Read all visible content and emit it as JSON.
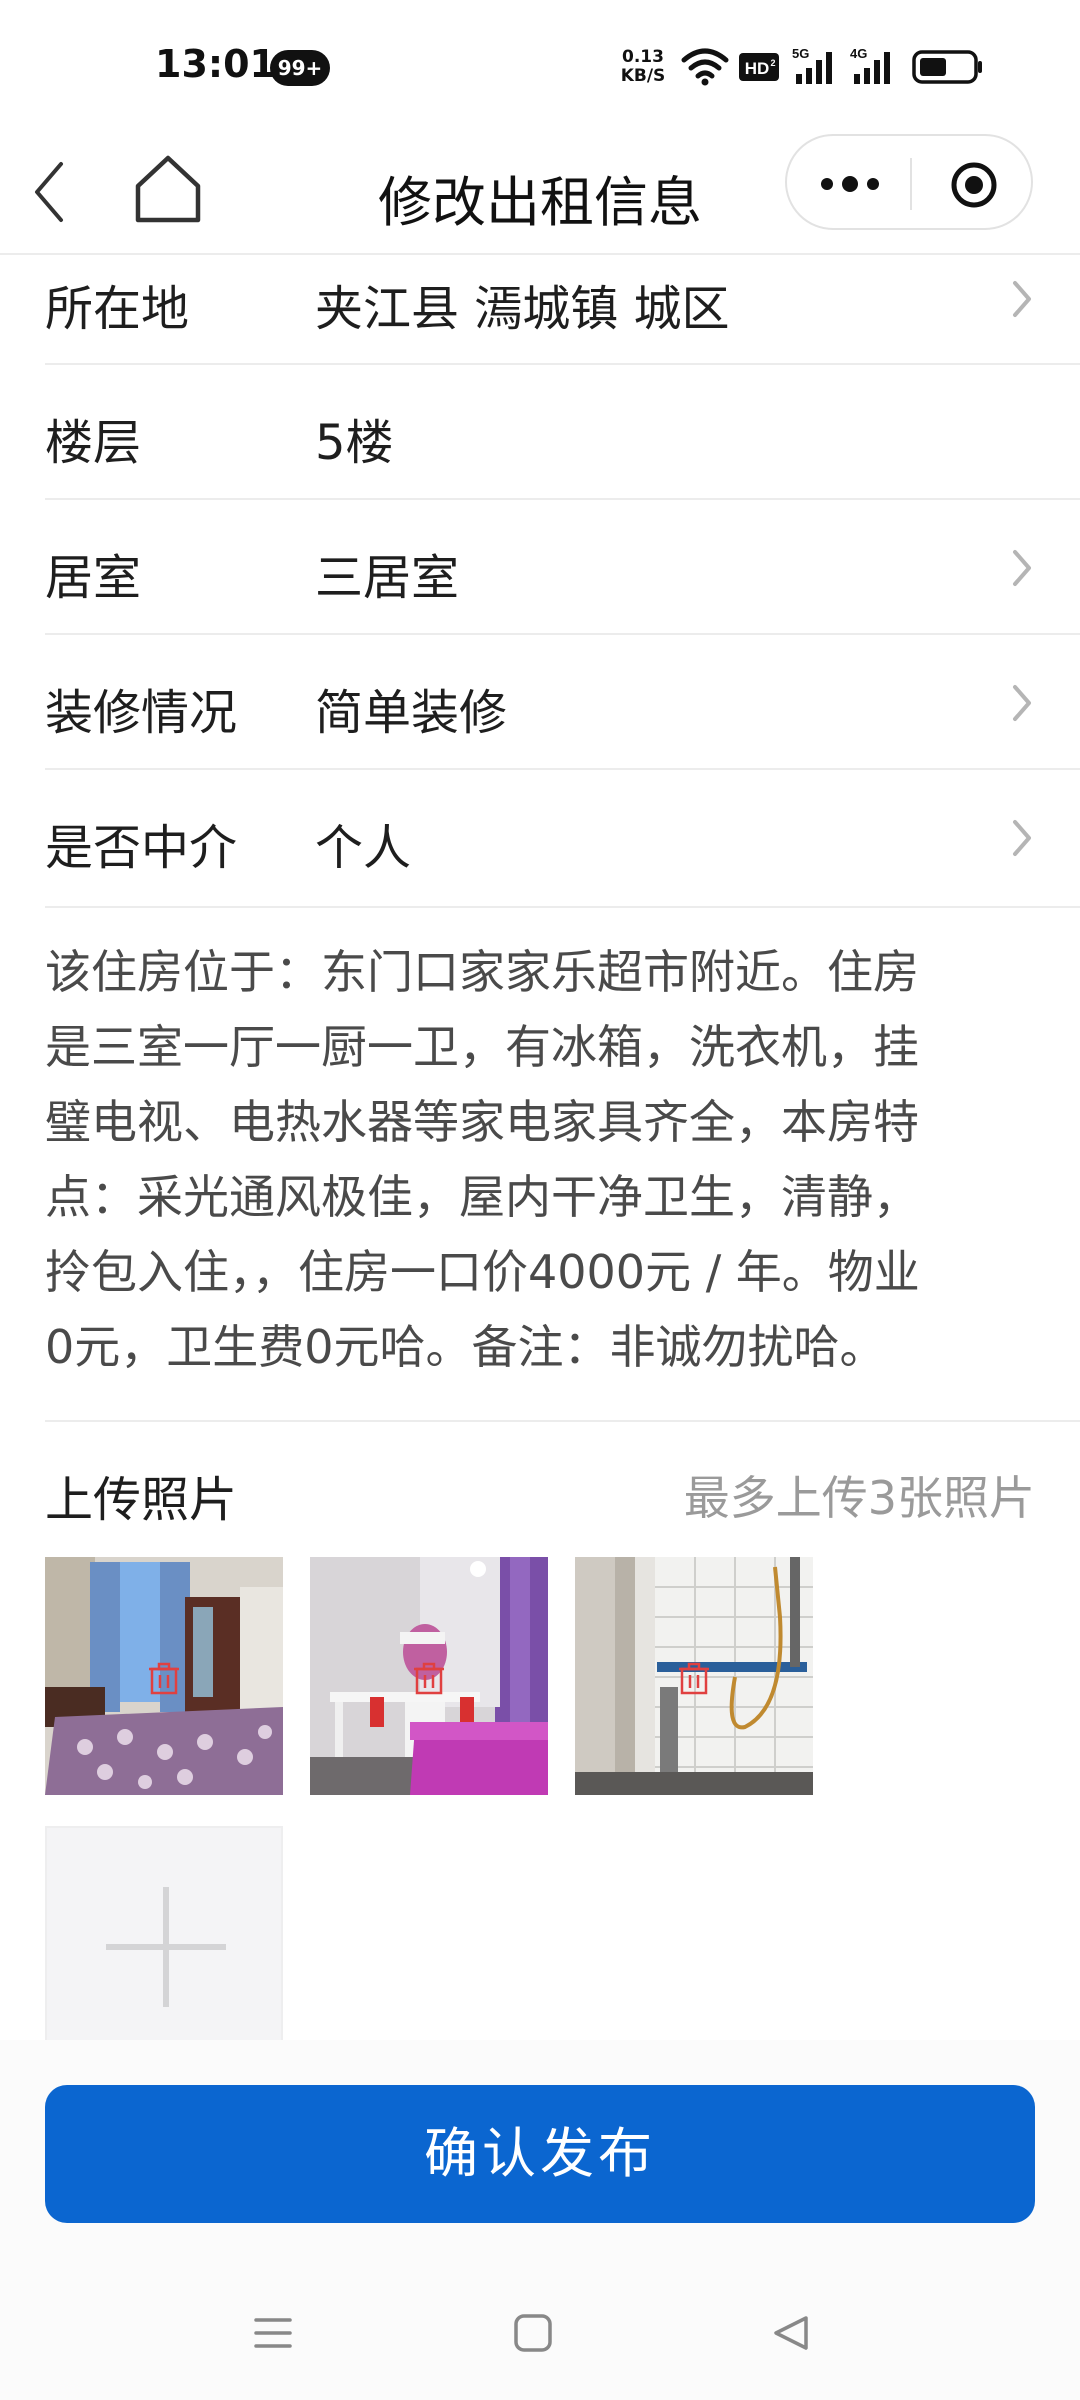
{
  "status_bar": {
    "time": "13:01",
    "notification_badge": "99+",
    "net_speed_value": "0.13",
    "net_speed_unit": "KB/S",
    "icons": [
      "wifi-icon",
      "hd-icon",
      "5g-signal-icon",
      "4g-signal-icon",
      "battery-icon"
    ]
  },
  "nav": {
    "title": "修改出租信息",
    "icons": [
      "back-icon",
      "home-icon",
      "more-icon",
      "target-icon"
    ]
  },
  "form": {
    "rows": [
      {
        "label": "所在地",
        "value": "夹江县 漹城镇 城区",
        "has_chevron": true
      },
      {
        "label": "楼层",
        "value": "5楼",
        "has_chevron": false
      },
      {
        "label": "居室",
        "value": "三居室",
        "has_chevron": true
      },
      {
        "label": "装修情况",
        "value": "简单装修",
        "has_chevron": true
      },
      {
        "label": "是否中介",
        "value": "个人",
        "has_chevron": true
      }
    ]
  },
  "description": {
    "lines": [
      "该住房位于：东门口家家乐超市附近。住房",
      "是三室一厅一厨一卫，有冰箱，洗衣机，挂",
      "璧电视、电热水器等家电家具齐全，本房特",
      "点：采光通风极佳，屋内干净卫生，清静，",
      "拎包入住，，住房一口价4000元 / 年。物业",
      "0元，卫生费0元哈。备注：非诚勿扰哈。"
    ]
  },
  "upload": {
    "title": "上传照片",
    "hint": "最多上传3张照片",
    "photos": [
      "bedroom-photo",
      "bedroom-vanity-photo",
      "bathroom-photo"
    ]
  },
  "actions": {
    "confirm_label": "确认发布"
  },
  "colors": {
    "primary": "#0b66d0",
    "delete_icon": "#e04040",
    "hint_text": "#9a9a9a"
  }
}
